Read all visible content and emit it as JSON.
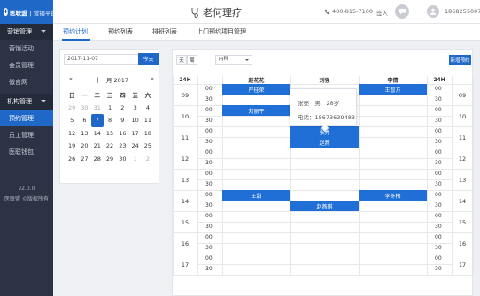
{
  "brand": {
    "name": "医联盟",
    "platform": "营销平台"
  },
  "header": {
    "clinic": "老何理疗",
    "phone": "400-815-7100",
    "signin": "签入",
    "user": "18682550070"
  },
  "sidebar": {
    "groups": [
      {
        "label": "营销管理",
        "items": [
          "营销活动",
          "会员管理",
          "微官网"
        ]
      },
      {
        "label": "机构管理",
        "items": [
          "预约管理",
          "员工管理",
          "医联钱包"
        ]
      }
    ],
    "active": "预约管理",
    "version": "v2.0.0",
    "copyright": "医联盟 ©版权所有"
  },
  "tabs": [
    "预约计划",
    "预约列表",
    "排班列表",
    "上门预约项目管理"
  ],
  "calendar": {
    "date_value": "2017-11-07",
    "today_label": "今天",
    "month_title": "十一月 2017",
    "weekdays": [
      "日",
      "一",
      "二",
      "三",
      "四",
      "五",
      "六"
    ],
    "weeks": [
      [
        "29",
        "30",
        "31",
        "1",
        "2",
        "3",
        "4"
      ],
      [
        "5",
        "6",
        "7",
        "8",
        "9",
        "10",
        "11"
      ],
      [
        "12",
        "13",
        "14",
        "15",
        "16",
        "17",
        "18"
      ],
      [
        "19",
        "20",
        "21",
        "22",
        "23",
        "24",
        "25"
      ],
      [
        "26",
        "27",
        "28",
        "29",
        "30",
        "1",
        "2"
      ]
    ],
    "selected": "7"
  },
  "schedule": {
    "view_day": "天",
    "view_week": "周",
    "department": "内科",
    "new_button": "新增预约",
    "hour_col": "24H",
    "doctors": [
      "赵花花",
      "刘强",
      "李倩"
    ],
    "hours": [
      "09",
      "10",
      "11",
      "12",
      "13",
      "14",
      "15",
      "16",
      "17"
    ],
    "minutes": [
      "00",
      "30"
    ],
    "appointments": [
      {
        "name": "严桂荣",
        "col": 0,
        "slot": 0
      },
      {
        "name": "王智方",
        "col": 2,
        "slot": 0
      },
      {
        "name": "刘丽平",
        "col": 0,
        "slot": 2
      },
      {
        "name": "张亮",
        "col": 1,
        "slot": 4
      },
      {
        "name": "赵燕",
        "col": 1,
        "slot": 5
      },
      {
        "name": "王甜",
        "col": 0,
        "slot": 10
      },
      {
        "name": "李冬梅",
        "col": 2,
        "slot": 10
      },
      {
        "name": "赵燕琪",
        "col": 1,
        "slot": 11
      }
    ],
    "popup": {
      "line1": "张亮　男　28岁",
      "line2": "电话：18673639483"
    }
  },
  "colors": {
    "accent": "#1f68c8",
    "sidebar": "#2b3345"
  }
}
